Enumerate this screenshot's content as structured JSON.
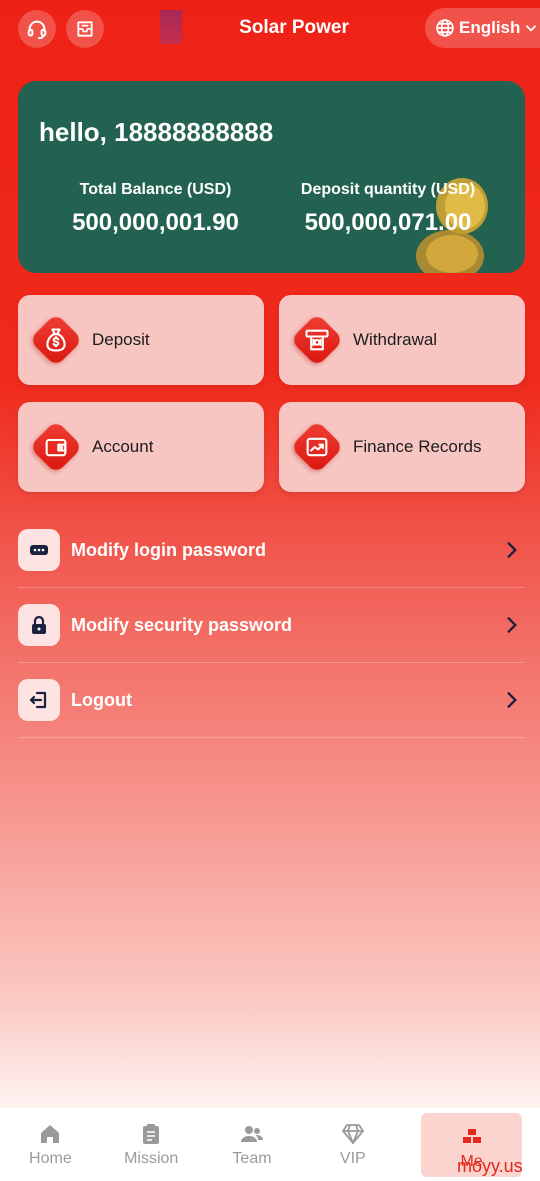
{
  "header": {
    "title": "Solar Power",
    "language": "English",
    "support_icon": "headset-icon",
    "message_icon": "inbox-icon",
    "lang_icon": "globe-icon"
  },
  "card": {
    "greeting": "hello, 18888888888",
    "total_balance_label": "Total Balance (USD)",
    "total_balance_value": "500,000,001.90",
    "deposit_label": "Deposit quantity (USD)",
    "deposit_value": "500,000,071.00"
  },
  "tiles": [
    {
      "label": "Deposit",
      "icon": "money-bag-icon"
    },
    {
      "label": "Withdrawal",
      "icon": "atm-icon"
    },
    {
      "label": "Account",
      "icon": "wallet-icon"
    },
    {
      "label": "Finance Records",
      "icon": "chart-icon"
    }
  ],
  "menu": [
    {
      "label": "Modify login password",
      "icon": "password-icon"
    },
    {
      "label": "Modify security password",
      "icon": "lock-icon"
    },
    {
      "label": "Logout",
      "icon": "logout-icon"
    }
  ],
  "nav": [
    {
      "label": "Home",
      "icon": "home-icon"
    },
    {
      "label": "Mission",
      "icon": "clipboard-icon"
    },
    {
      "label": "Team",
      "icon": "team-icon"
    },
    {
      "label": "VIP",
      "icon": "diamond-icon"
    },
    {
      "label": "Me",
      "icon": "bricks-icon",
      "active": true
    }
  ],
  "watermark": "moyy.us",
  "colors": {
    "accent": "#e5271d",
    "card": "#236250"
  }
}
